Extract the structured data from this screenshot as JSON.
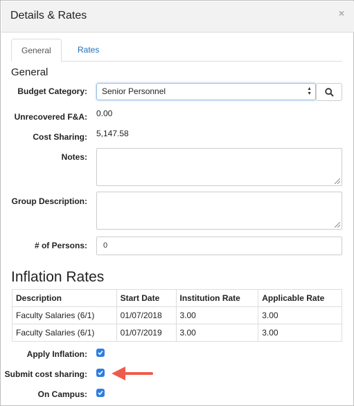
{
  "dialog": {
    "title": "Details & Rates"
  },
  "tabs": [
    {
      "label": "General"
    },
    {
      "label": "Rates"
    }
  ],
  "general": {
    "section_title": "General",
    "budget_category": {
      "label": "Budget Category:",
      "value": "Senior Personnel"
    },
    "unrecovered_fa": {
      "label": "Unrecovered F&A:",
      "value": "0.00"
    },
    "cost_sharing": {
      "label": "Cost Sharing:",
      "value": "5,147.58"
    },
    "notes": {
      "label": "Notes:"
    },
    "group_description": {
      "label": "Group Description:"
    },
    "num_persons": {
      "label": "# of Persons:",
      "value": "0"
    }
  },
  "inflation": {
    "section_title": "Inflation Rates",
    "columns": [
      "Description",
      "Start Date",
      "Institution Rate",
      "Applicable Rate"
    ],
    "rows": [
      [
        "Faculty Salaries (6/1)",
        "01/07/2018",
        "3.00",
        "3.00"
      ],
      [
        "Faculty Salaries (6/1)",
        "01/07/2019",
        "3.00",
        "3.00"
      ]
    ]
  },
  "options": {
    "apply_inflation": {
      "label": "Apply Inflation:",
      "checked": true
    },
    "submit_cost_sharing": {
      "label": "Submit cost sharing:",
      "checked": true
    },
    "on_campus": {
      "label": "On Campus:",
      "checked": true
    }
  },
  "colors": {
    "accent": "#1a6fb8",
    "checkbox": "#2f7de1",
    "annotation_arrow": "#ef5b4b"
  }
}
